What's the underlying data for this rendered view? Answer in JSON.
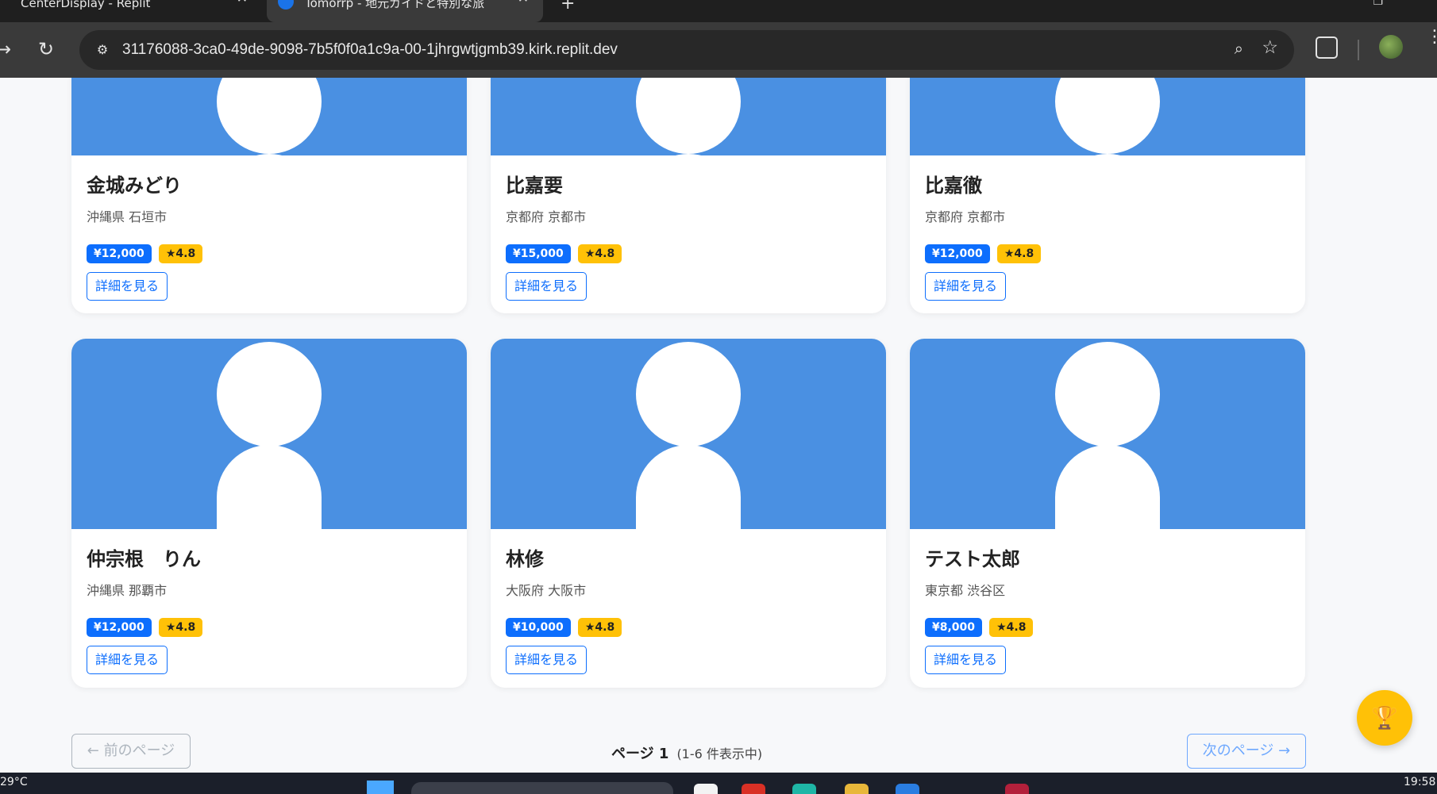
{
  "browser": {
    "tabs": [
      {
        "title": "CenterDisplay - Replit",
        "close": "✕"
      },
      {
        "title": "Tomorrp - 地元ガイドと特別な旅",
        "close": "✕"
      }
    ],
    "new_tab": "+",
    "url": "31176088-3ca0-49de-9098-7b5f0f0a1c9a-00-1jhrgwtjgmb39.kirk.replit.dev"
  },
  "guides": [
    {
      "name": "金城みどり",
      "location": "沖縄県 石垣市",
      "price": "¥12,000",
      "rating": "★4.8",
      "button": "詳細を見る"
    },
    {
      "name": "比嘉要",
      "location": "京都府 京都市",
      "price": "¥15,000",
      "rating": "★4.8",
      "button": "詳細を見る"
    },
    {
      "name": "比嘉徹",
      "location": "京都府 京都市",
      "price": "¥12,000",
      "rating": "★4.8",
      "button": "詳細を見る"
    },
    {
      "name": "仲宗根　りん",
      "location": "沖縄県 那覇市",
      "price": "¥12,000",
      "rating": "★4.8",
      "button": "詳細を見る"
    },
    {
      "name": "林修",
      "location": "大阪府 大阪市",
      "price": "¥10,000",
      "rating": "★4.8",
      "button": "詳細を見る"
    },
    {
      "name": "テスト太郎",
      "location": "東京都 渋谷区",
      "price": "¥8,000",
      "rating": "★4.8",
      "button": "詳細を見る"
    }
  ],
  "pagination": {
    "prev": "← 前のページ",
    "page_label": "ページ 1",
    "count": "(1-6 件表示中)",
    "next": "次のページ →"
  },
  "taskbar": {
    "temperature": "29°C",
    "time": "19:58"
  },
  "colors": {
    "primary": "#0d6efd",
    "rating": "#ffc107",
    "card_image": "#4a90e2"
  }
}
